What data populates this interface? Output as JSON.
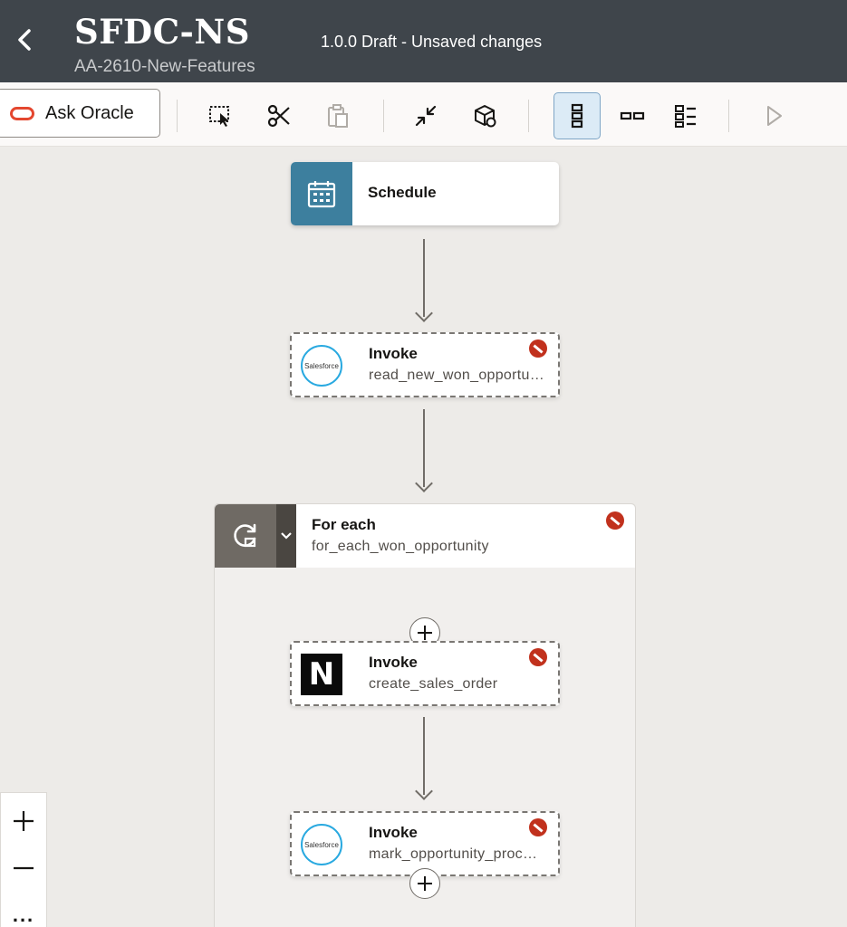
{
  "header": {
    "title": "SFDC-NS",
    "subtitle": "AA-2610-New-Features",
    "version": "1.0.0 Draft - Unsaved changes"
  },
  "toolbar": {
    "ask_oracle_label": "Ask Oracle",
    "icons": [
      "select-icon",
      "cut-icon",
      "paste-icon",
      "collapse-icon",
      "package-icon",
      "vertical-layout-icon",
      "horizontal-layout-icon",
      "pseudo-layout-icon",
      "run-icon"
    ]
  },
  "flow": {
    "schedule": {
      "title": "Schedule"
    },
    "invoke1": {
      "title": "Invoke",
      "subtitle": "read_new_won_opportunities",
      "logo_text": "Salesforce"
    },
    "foreach": {
      "title": "For each",
      "subtitle": "for_each_won_opportunity"
    },
    "invoke2": {
      "title": "Invoke",
      "subtitle": "create_sales_order",
      "logo_text": "N"
    },
    "invoke3": {
      "title": "Invoke",
      "subtitle": "mark_opportunity_processed",
      "logo_text": "Salesforce"
    }
  },
  "zoom": {
    "more_label": "..."
  },
  "colors": {
    "header_bg": "#3f454b",
    "error": "#c1311d",
    "schedule_accent": "#3d7f9e",
    "salesforce": "#29a9e0"
  }
}
